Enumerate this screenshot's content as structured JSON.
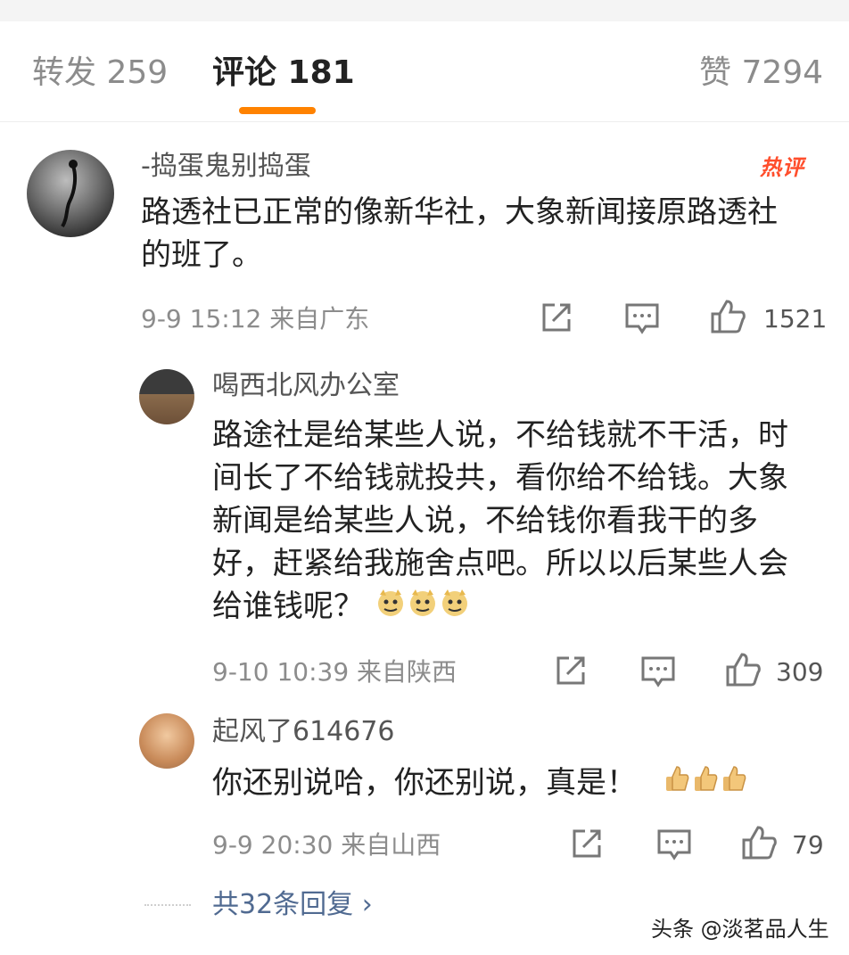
{
  "tabs": {
    "repost": "转发 259",
    "comments": "评论 181",
    "likes": "赞 7294"
  },
  "colors": {
    "accent": "#ff8200",
    "hot_badge": "#ff4e2c",
    "link": "#506a91"
  },
  "comment": {
    "username": "-捣蛋鬼别捣蛋",
    "badge": "热评",
    "text": "路透社已正常的像新华社，大象新闻接原路透社的班了。",
    "meta": "9-9 15:12 来自广东",
    "likes": "1521"
  },
  "replies": [
    {
      "username": "喝西北风办公室",
      "text": "路途社是给某些人说，不给钱就不干活，时间长了不给钱就投共，看你给不给钱。大象新闻是给某些人说，不给钱你看我干的多好，赶紧给我施舍点吧。所以以后某些人会给谁钱呢？",
      "emoji": "doge-icon x3",
      "meta": "9-10 10:39 来自陕西",
      "likes": "309"
    },
    {
      "username": "起风了614676",
      "text": "你还别说哈，你还别说，真是！",
      "emoji": "thumbs-up-icon x3",
      "meta": "9-9 20:30 来自山西",
      "likes": "79"
    }
  ],
  "more_replies": "共32条回复 ›",
  "watermark": "头条 @淡茗品人生"
}
